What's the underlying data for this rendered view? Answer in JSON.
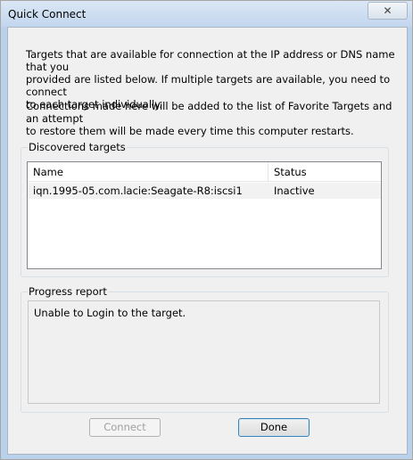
{
  "window": {
    "title": "Quick Connect",
    "close_glyph": "✕"
  },
  "intro": {
    "line1": "Targets that are available for connection at the IP address or DNS name that you",
    "line2": "provided are listed below.  If multiple targets are available, you need to connect",
    "line3": "to each target individually."
  },
  "note": {
    "line1": "Connections made here will be added to the list of Favorite Targets and an attempt",
    "line2": "to restore them will be made every time this computer restarts."
  },
  "discovered": {
    "label": "Discovered targets",
    "columns": {
      "name": "Name",
      "status": "Status"
    },
    "rows": [
      {
        "name": "iqn.1995-05.com.lacie:Seagate-R8:iscsi1",
        "status": "Inactive"
      }
    ]
  },
  "progress": {
    "label": "Progress report",
    "message": "Unable to Login to the target."
  },
  "buttons": {
    "connect": "Connect",
    "done": "Done"
  }
}
